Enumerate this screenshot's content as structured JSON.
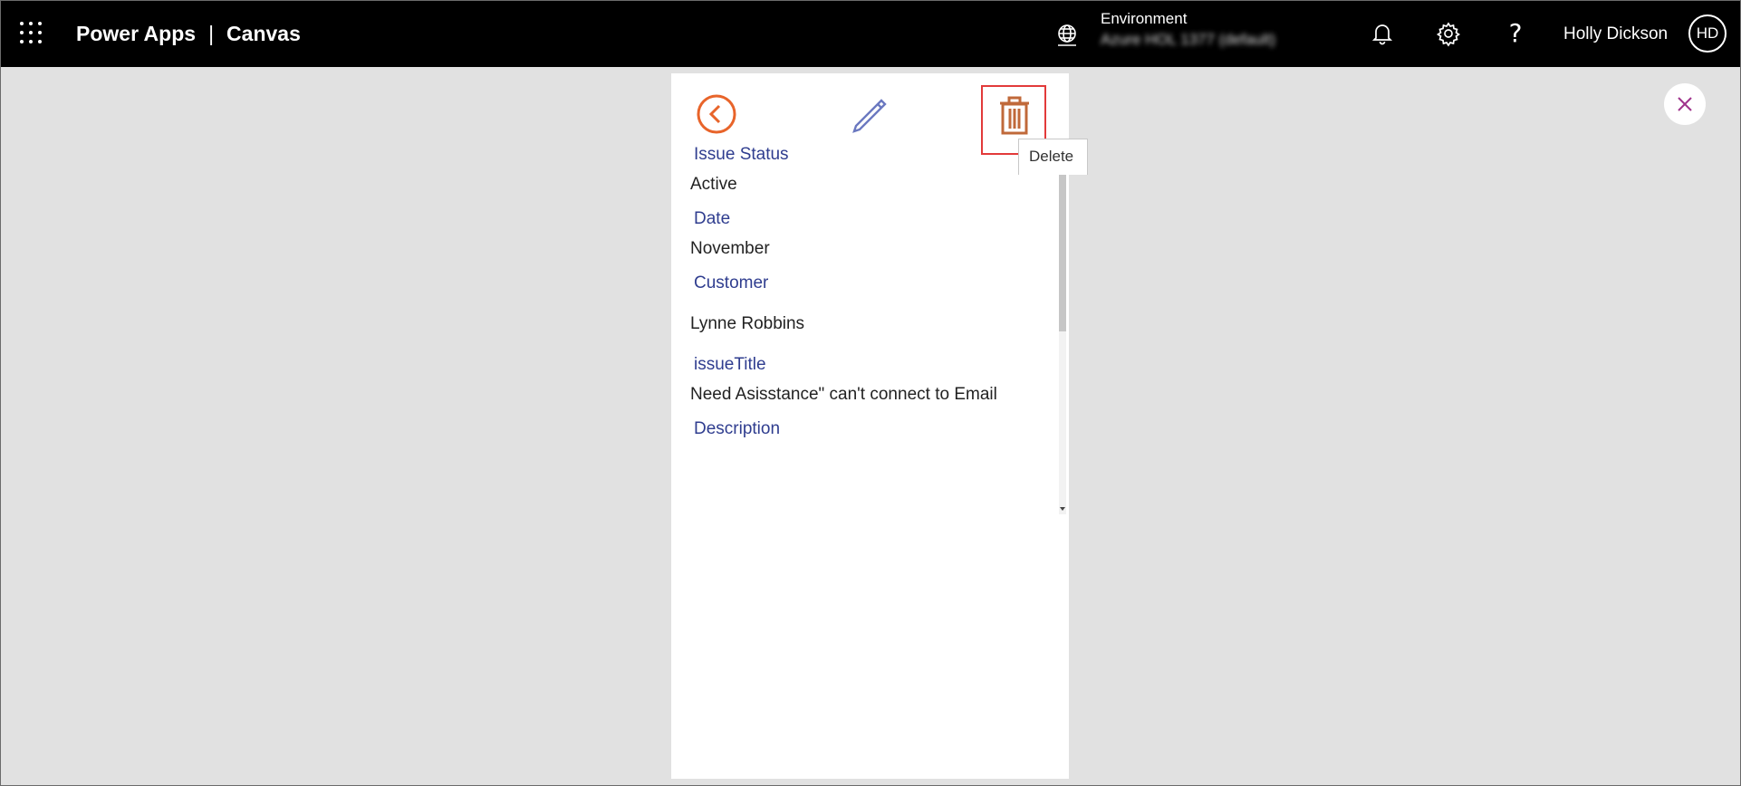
{
  "header": {
    "app_name": "Power Apps",
    "separator": "|",
    "app_type": "Canvas",
    "environment_label": "Environment",
    "environment_value": "Azure HOL 1377 (default)",
    "help_glyph": "?",
    "user_name": "Holly Dickson",
    "user_initials": "HD"
  },
  "toolbar": {
    "delete_tooltip": "Delete"
  },
  "fields": [
    {
      "label": "Issue Status",
      "value": "Active"
    },
    {
      "label": "Date",
      "value": "November"
    },
    {
      "label": "Customer",
      "value": "Lynne Robbins"
    },
    {
      "label": "issueTitle",
      "value": "Need Asisstance\" can't connect to Email"
    },
    {
      "label": "Description",
      "value": ""
    }
  ],
  "colors": {
    "header_bg": "#000000",
    "canvas_bg": "#e1e1e1",
    "accent_orange": "#e8642a",
    "label_blue": "#2f3d8f",
    "edit_icon": "#6a78c0",
    "delete_icon": "#c0693a",
    "highlight_red": "#e23a3a",
    "close_icon": "#a0338c"
  },
  "icons": {
    "waffle": "app-launcher-icon",
    "environment": "globe-icon",
    "bell": "bell-icon",
    "gear": "gear-icon",
    "back": "chevron-left-circle-icon",
    "edit": "pencil-icon",
    "delete": "trash-icon",
    "close": "close-icon"
  }
}
